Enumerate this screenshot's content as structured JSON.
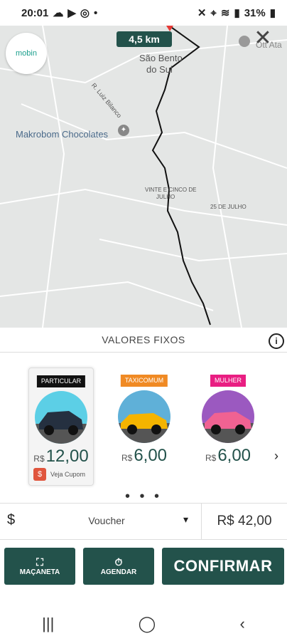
{
  "status_bar": {
    "time": "20:01",
    "battery": "31%"
  },
  "map": {
    "distance": "4,5 km",
    "labels": {
      "sao_bento_1": "São Bento",
      "sao_bento_2": "do Sul",
      "street_luiz": "R. Luiz Bilanco",
      "poi": "Makrobom Chocolates",
      "vinte_cinco_1": "VINTE E CINCO DE",
      "vinte_cinco_2": "JULHO",
      "julho_25": "25 DE JULHO",
      "top_right": "Ott Ata",
      "logo": "mobin"
    }
  },
  "panel": {
    "title": "VALORES FIXOS",
    "cards": [
      {
        "tag": "PARTICULAR",
        "currency": "R$",
        "price": "12,00",
        "coupon": "Veja Cupom",
        "tag_color": "#111111"
      },
      {
        "tag": "TAXICOMUM",
        "currency": "R$",
        "price": "6,00",
        "tag_color": "#f08a24"
      },
      {
        "tag": "MULHER",
        "currency": "R$",
        "price": "6,00",
        "tag_color": "#e91e82"
      }
    ],
    "dots": "• • •"
  },
  "payment": {
    "symbol": "$",
    "method": "Voucher",
    "total": "R$ 42,00"
  },
  "buttons": {
    "macaneta": "MAÇANETA",
    "agendar": "AGENDAR",
    "confirmar": "CONFIRMAR"
  },
  "colors": {
    "primary": "#23524b",
    "map_bg": "#e4e6e5"
  }
}
